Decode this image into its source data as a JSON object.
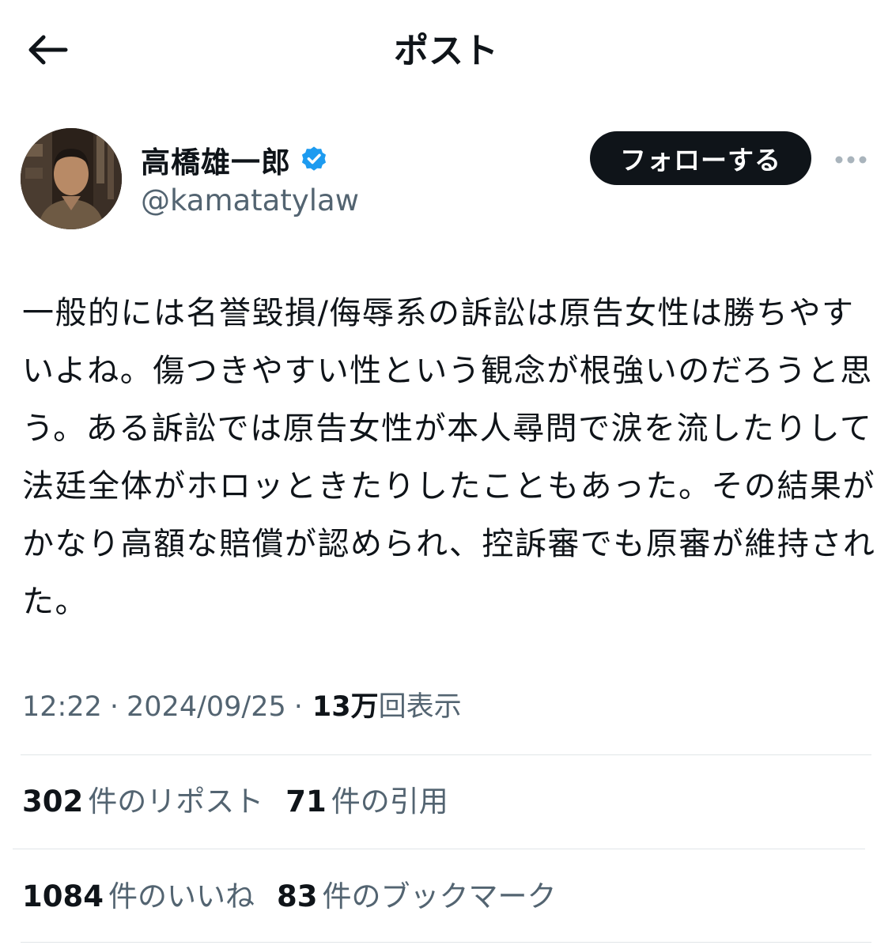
{
  "header": {
    "title": "ポスト",
    "back_icon": "arrow-left-icon"
  },
  "author": {
    "display_name": "高橋雄一郎",
    "handle": "@kamatatylaw",
    "verified": true,
    "verified_color": "#1d9bf0",
    "follow_label": "フォローする",
    "more_icon": "ellipsis-icon"
  },
  "tweet": {
    "text": "一般的には名誉毀損/侮辱系の訴訟は原告女性は勝ちやすいよね。傷つきやすい性という観念が根強いのだろうと思う。ある訴訟では原告女性が本人尋問で涙を流したりして法廷全体がホロッときたりしたこともあった。その結果がかなり高額な賠償が認められ、控訴審でも原審が維持された。"
  },
  "meta": {
    "time": "12:22",
    "date": "2024/09/25",
    "sep": "·",
    "views_count": "13万",
    "views_label": "回表示"
  },
  "stats": {
    "reposts": {
      "count": "302",
      "label": "件のリポスト"
    },
    "quotes": {
      "count": "71",
      "label": "件の引用"
    },
    "likes": {
      "count": "1084",
      "label": "件のいいね"
    },
    "bookmarks": {
      "count": "83",
      "label": "件のブックマーク"
    }
  },
  "colors": {
    "text": "#0f1419",
    "secondary": "#536471",
    "divider": "#e1e5e8",
    "button_bg": "#0f1419"
  }
}
